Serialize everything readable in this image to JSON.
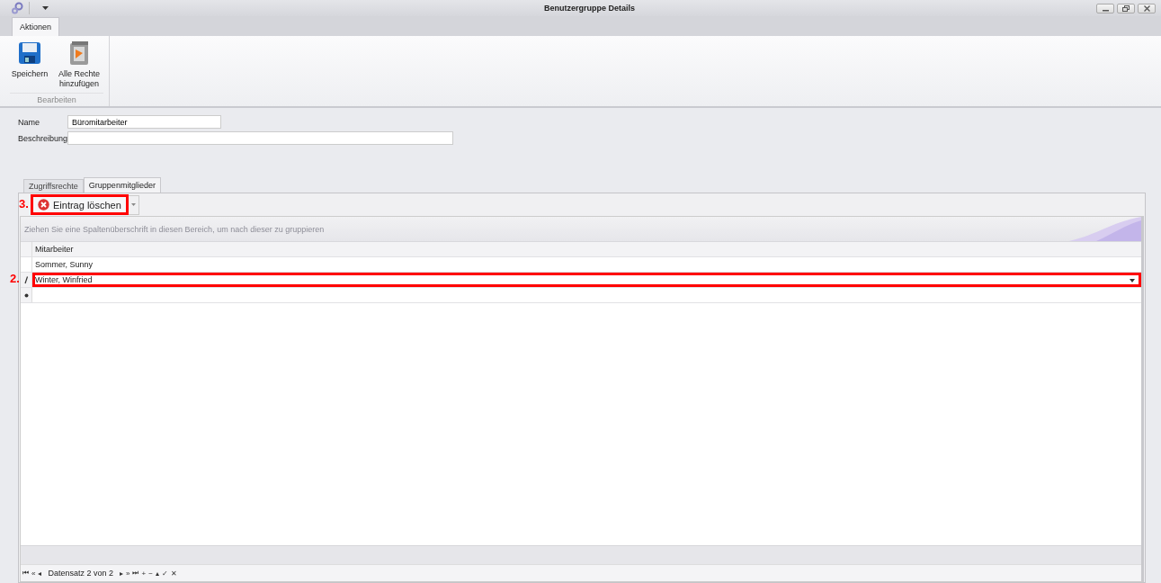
{
  "window": {
    "title": "Benutzergruppe Details"
  },
  "ribbon": {
    "tabs": [
      {
        "label": "Aktionen",
        "selected": true
      }
    ],
    "groups": [
      {
        "label": "Bearbeiten",
        "buttons": [
          {
            "kind": "save",
            "label": "Speichern"
          },
          {
            "kind": "rights",
            "label": "Alle Rechte hinzufügen"
          }
        ]
      }
    ]
  },
  "form": {
    "fields": [
      {
        "label": "Name",
        "value": "Büromitarbeiter"
      },
      {
        "label": "Beschreibung"
      }
    ]
  },
  "tabs": [
    {
      "label": "Zugriffsrechte",
      "selected": false
    },
    {
      "label": "Gruppenmitglieder",
      "selected": true
    }
  ],
  "toolbar": {
    "button": {
      "label": "Eintrag löschen",
      "annotation": "3."
    }
  },
  "grid": {
    "group_panel_hint": "Ziehen Sie eine Spaltenüberschrift in diesen Bereich, um nach dieser zu gruppieren",
    "columns": [
      "Mitarbeiter"
    ],
    "rows": [
      {
        "kind": "normal",
        "cells": [
          "Sommer, Sunny"
        ]
      },
      {
        "kind": "editing",
        "cells": [
          "Winter, Winfried"
        ],
        "annotation": "2."
      },
      {
        "kind": "new"
      }
    ]
  },
  "navigator": {
    "buttons_before": [
      "⏮",
      "«",
      "◂"
    ],
    "text": "Datensatz 2 von 2",
    "buttons_after": [
      "▸",
      "»",
      "⏭",
      "+",
      "−",
      "▴",
      "✓",
      "✕"
    ]
  }
}
